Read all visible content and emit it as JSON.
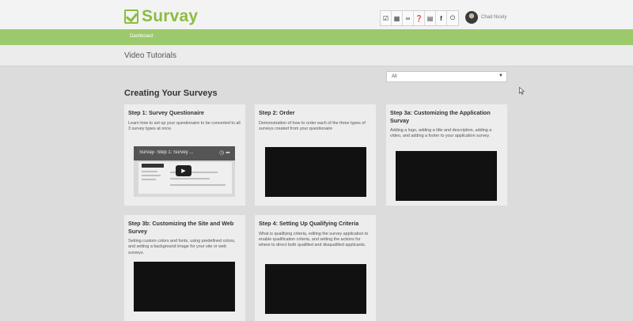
{
  "header": {
    "logo_text": "Survay",
    "brand_color": "#8cbd3f",
    "icons": [
      "checkbox-icon",
      "calendar-icon",
      "link-icon",
      "help-icon",
      "book-icon",
      "facebook-icon",
      "power-icon"
    ],
    "user_name": "Chad Nicely"
  },
  "nav": {
    "dashboard_label": "Dashboard",
    "color": "#9cc96b"
  },
  "page": {
    "title": "Video Tutorials",
    "filter_value": "All",
    "section_title": "Creating Your Surveys"
  },
  "cards": [
    {
      "title": "Step 1: Survey Questionaire",
      "desc": "Learn how to set up your questionaire to be converted to all 3 survey types at once.",
      "video_title": "Survay- Step 1: Survey ..."
    },
    {
      "title": "Step 2: Order",
      "desc": "Demonstration of how to order each of the three types of surveys created from your questionaire"
    },
    {
      "title": "Step 3a: Customizing the Application Survay",
      "desc": "Adding a logo, adding a title and description, adding a video, and adding a footer to your application survey."
    },
    {
      "title": "Step 3b: Customizing the Site and Web Survey",
      "desc": "Setting custom colors and fonts, using predefined colors, and setting a background image for your site or web surveys."
    },
    {
      "title": "Step 4: Setting Up Qualifying Criteria",
      "desc": "What is qualifying criteria, editing the survey application to enable qualification criteria, and setting the actions for where to direct both qualified and disqualified applicants."
    }
  ]
}
